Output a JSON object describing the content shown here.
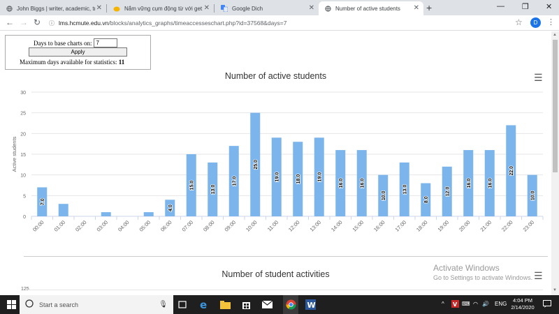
{
  "browser": {
    "tabs": [
      {
        "title": "John Biggs | writer, academic, tra",
        "icon": "globe-icon"
      },
      {
        "title": "Nắm vững cụm động từ với get;",
        "icon": "hand-icon"
      },
      {
        "title": "Google Dich",
        "icon": "translate-icon"
      },
      {
        "title": "Number of active students",
        "icon": "globe-icon"
      }
    ],
    "url_host": "lms.hcmute.edu.vn",
    "url_path": "/blocks/analytics_graphs/timeaccesseschart.php?id=37568&days=7",
    "profile_initial": "D"
  },
  "form": {
    "days_label": "Days to base charts on:",
    "days_value": "7",
    "apply_label": "Apply",
    "max_label": "Maximum days available for statistics:",
    "max_value": "11"
  },
  "chart_data": {
    "type": "bar",
    "title": "Number of active students",
    "ylabel": "Active students",
    "xlabel": "",
    "ylim": [
      0,
      30
    ],
    "yticks": [
      0,
      5,
      10,
      15,
      20,
      25,
      30
    ],
    "categories": [
      "00:00",
      "01:00",
      "02:00",
      "03:00",
      "04:00",
      "05:00",
      "06:00",
      "07:00",
      "08:00",
      "09:00",
      "10:00",
      "11:00",
      "12:00",
      "13:00",
      "14:00",
      "15:00",
      "16:00",
      "17:00",
      "18:00",
      "19:00",
      "20:00",
      "21:00",
      "22:00",
      "23:00"
    ],
    "values": [
      7,
      3,
      0,
      1,
      0,
      1,
      4,
      15,
      13,
      17,
      25,
      19,
      18,
      19,
      16,
      16,
      10,
      13,
      8,
      12,
      16,
      16,
      22,
      10
    ],
    "data_labels": [
      "7.0",
      "",
      "",
      "",
      "",
      "",
      "4.0",
      "15.0",
      "13.0",
      "17.0",
      "25.0",
      "19.0",
      "18.0",
      "19.0",
      "16.0",
      "16.0",
      "10.0",
      "13.0",
      "8.0",
      "12.0",
      "16.0",
      "16.0",
      "22.0",
      "10.0"
    ],
    "bar_color": "#7cb5ec",
    "grid": true
  },
  "chart2": {
    "title": "Number of student activities",
    "first_tick": "125"
  },
  "watermark": {
    "line1": "Activate Windows",
    "line2": "Go to Settings to activate Windows."
  },
  "taskbar": {
    "search_placeholder": "Start a search",
    "language": "ENG",
    "time": "4:04 PM",
    "date": "2/14/2020"
  }
}
